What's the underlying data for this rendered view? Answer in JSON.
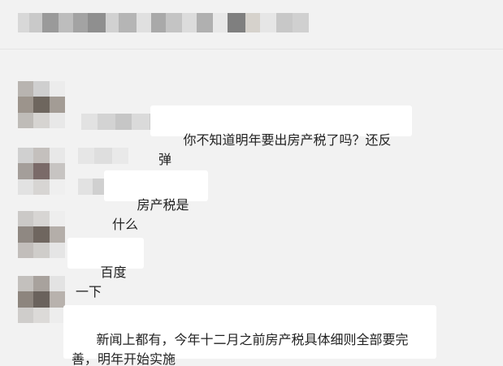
{
  "chat": {
    "title_redacted": true,
    "messages": [
      {
        "avatar": "blurred-avatar",
        "text": "你不知道明年要出房产税了吗？还反弹"
      },
      {
        "avatar": "blurred-avatar",
        "text": "房产税是什么"
      },
      {
        "avatar": "blurred-avatar",
        "text": "百度一下"
      },
      {
        "avatar": "blurred-avatar",
        "text": "新闻上都有，今年十二月之前房产税具体细则全部要完\n善，明年开始实施"
      }
    ]
  },
  "colors": {
    "background": "#f2f2f2",
    "bubble": "#ffffff",
    "text": "#222222",
    "divider": "#e4e4e4"
  }
}
